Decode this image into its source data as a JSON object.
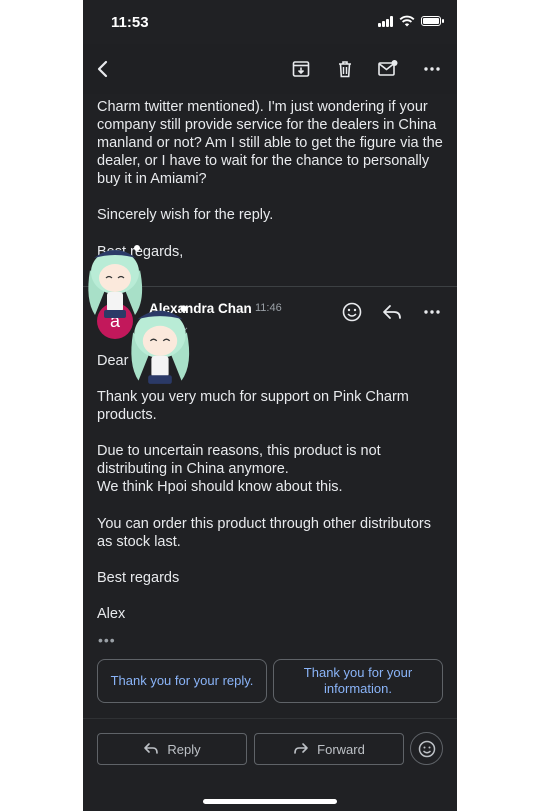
{
  "status": {
    "time": "11:53"
  },
  "toolbar": {
    "icons": [
      "back-icon",
      "archive-icon",
      "delete-icon",
      "mark-unread-icon",
      "more-icon"
    ]
  },
  "previous_message": {
    "body": "Charm twitter mentioned). I'm just wondering if your company still provide service for the dealers in China manland or not? Am I still able to get the figure via the dealer, or I have to wait for the chance to personally buy it in Amiami?",
    "closing": "Sincerely wish for the reply.",
    "signoff": "Best regards,"
  },
  "message": {
    "avatar_letter": "a",
    "sender": "Alexandra Chan",
    "time": "11:46",
    "greeting": "Dear",
    "para1": "Thank you very much for support on Pink Charm products.",
    "para2": "Due to uncertain reasons, this product is not distributing in China anymore.\nWe think Hpoi should know about this.",
    "para3": "You can order this product through other distributors as stock last.",
    "closing": "Best regards",
    "signature": "Alex",
    "more": "•••"
  },
  "smart_replies": [
    "Thank you for your reply.",
    "Thank you for your information."
  ],
  "actions": {
    "reply": "Reply",
    "forward": "Forward"
  },
  "colors": {
    "background": "#202124",
    "text": "#e8eaed",
    "accent_link": "#8ab4f8",
    "avatar": "#c2185b"
  }
}
